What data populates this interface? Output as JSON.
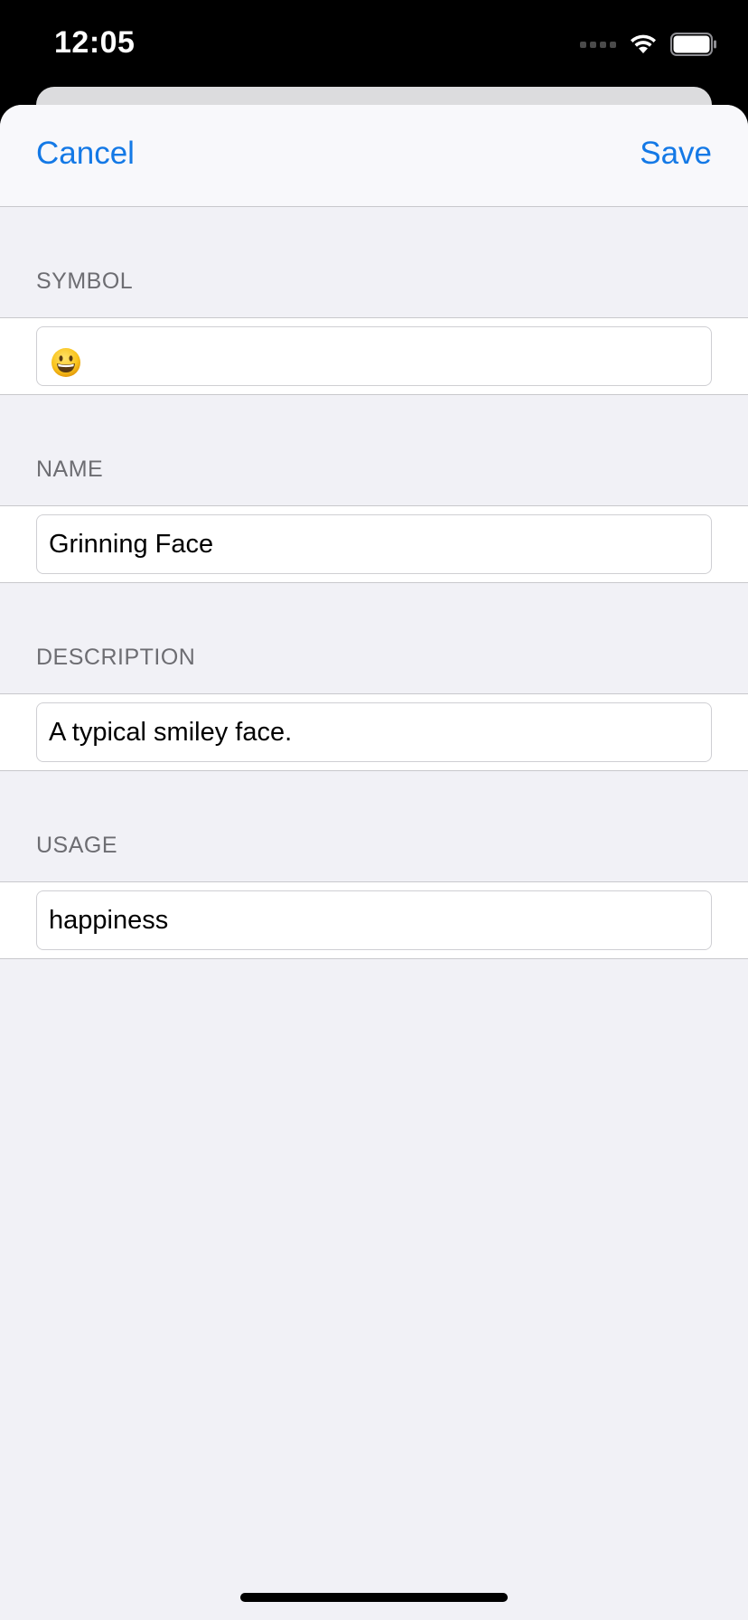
{
  "status_bar": {
    "time": "12:05"
  },
  "nav": {
    "cancel_label": "Cancel",
    "save_label": "Save"
  },
  "sections": {
    "symbol": {
      "header": "SYMBOL",
      "value": "grinning-face-emoji"
    },
    "name": {
      "header": "NAME",
      "value": "Grinning Face"
    },
    "description": {
      "header": "DESCRIPTION",
      "value": "A typical smiley face."
    },
    "usage": {
      "header": "USAGE",
      "value": "happiness"
    }
  },
  "colors": {
    "accent": "#1479e6",
    "background": "#f1f1f6",
    "header_text": "#6d6d72"
  }
}
